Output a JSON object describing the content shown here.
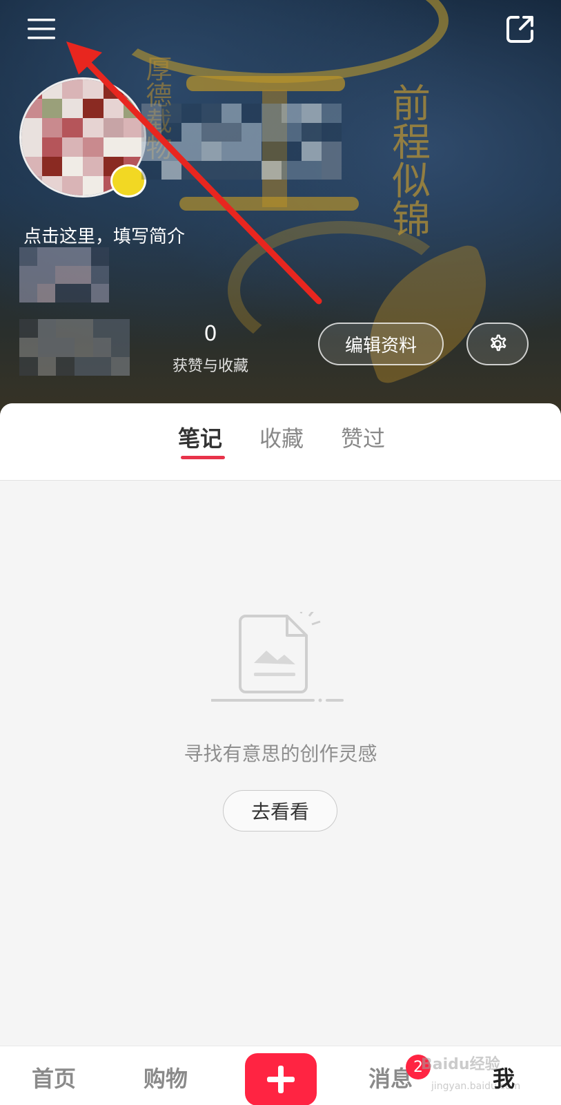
{
  "header": {
    "bio_placeholder": "点击这里，填写简介",
    "stat_value": "0",
    "stat_label": "获赞与收藏",
    "edit_profile_label": "编辑资料",
    "background_decoration_text": [
      "前程似锦",
      "厚德载物"
    ]
  },
  "tabs": [
    {
      "label": "笔记",
      "active": true
    },
    {
      "label": "收藏",
      "active": false
    },
    {
      "label": "赞过",
      "active": false
    }
  ],
  "empty_state": {
    "message": "寻找有意思的创作灵感",
    "button_label": "去看看"
  },
  "bottom_nav": {
    "items": [
      {
        "label": "首页"
      },
      {
        "label": "购物"
      },
      {
        "label": "消息",
        "badge": "2"
      },
      {
        "label": "我",
        "active": true
      }
    ]
  },
  "watermark": {
    "text": "Baidu经验",
    "sub": "jingyan.baidu.com"
  },
  "colors": {
    "accent": "#ff2442",
    "tab_underline": "#e8334a",
    "annotation_arrow": "#e8261f"
  },
  "icons": [
    "menu-icon",
    "share-icon",
    "settings-gear-icon",
    "empty-image-icon",
    "plus-icon"
  ]
}
